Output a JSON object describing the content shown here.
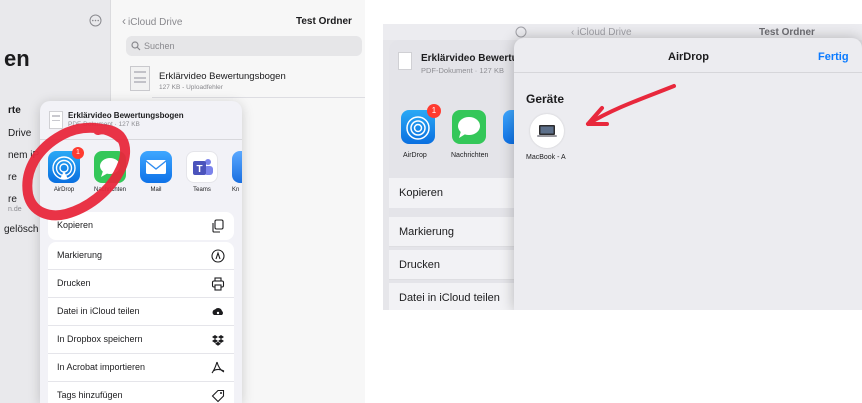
{
  "left": {
    "sidebar": {
      "more_icon": "ellipsis-circle-icon",
      "title_fragment": "en",
      "items": [
        "rte",
        "Drive",
        "nem iP",
        "re",
        "re",
        "n.de",
        "gelösch"
      ]
    },
    "header": {
      "back_label": "iCloud Drive",
      "title": "Test Ordner"
    },
    "search": {
      "placeholder": "Suchen"
    },
    "file": {
      "name": "Erklärvideo Bewertungsbogen",
      "meta": "127 KB - Uploadfehler"
    },
    "share_sheet": {
      "file_name": "Erklärvideo Bewertungsbogen",
      "file_meta": "PDF-Dokument · 127 KB",
      "apps": [
        {
          "label": "AirDrop",
          "icon": "airdrop-icon",
          "badge": "1"
        },
        {
          "label": "Nachrichten",
          "icon": "messages-icon"
        },
        {
          "label": "Mail",
          "icon": "mail-icon"
        },
        {
          "label": "Teams",
          "icon": "teams-icon"
        },
        {
          "label": "Kn",
          "icon": "keynote-icon"
        }
      ],
      "actions_group1": [
        {
          "label": "Kopieren",
          "icon": "copy-icon"
        }
      ],
      "actions_group2": [
        {
          "label": "Markierung",
          "icon": "markup-icon"
        },
        {
          "label": "Drucken",
          "icon": "printer-icon"
        },
        {
          "label": "Datei in iCloud teilen",
          "icon": "icloud-share-icon"
        },
        {
          "label": "In Dropbox speichern",
          "icon": "dropbox-icon"
        },
        {
          "label": "In Acrobat importieren",
          "icon": "acrobat-icon"
        },
        {
          "label": "Tags hinzufügen",
          "icon": "tag-icon"
        }
      ]
    },
    "annotation_color": "#e8283c"
  },
  "right": {
    "header": {
      "back_label": "iCloud Drive",
      "title": "Test Ordner"
    },
    "share_sheet": {
      "file_name": "Erklärvideo Bewertu",
      "file_meta": "PDF-Dokument · 127 KB",
      "apps": [
        {
          "label": "AirDrop",
          "icon": "airdrop-icon",
          "badge": "1"
        },
        {
          "label": "Nachrichten",
          "icon": "messages-icon"
        }
      ],
      "actions": [
        "Kopieren",
        "Markierung",
        "Drucken",
        "Datei in iCloud teilen"
      ]
    },
    "airdrop_panel": {
      "title": "AirDrop",
      "done_label": "Fertig",
      "section_title": "Geräte",
      "devices": [
        {
          "name": "MacBook - A",
          "icon": "laptop-icon"
        }
      ]
    },
    "annotation_color": "#e8283c"
  },
  "colors": {
    "accent": "#0a7aff",
    "badge": "#ff3b30",
    "annotation": "#e8283c"
  }
}
